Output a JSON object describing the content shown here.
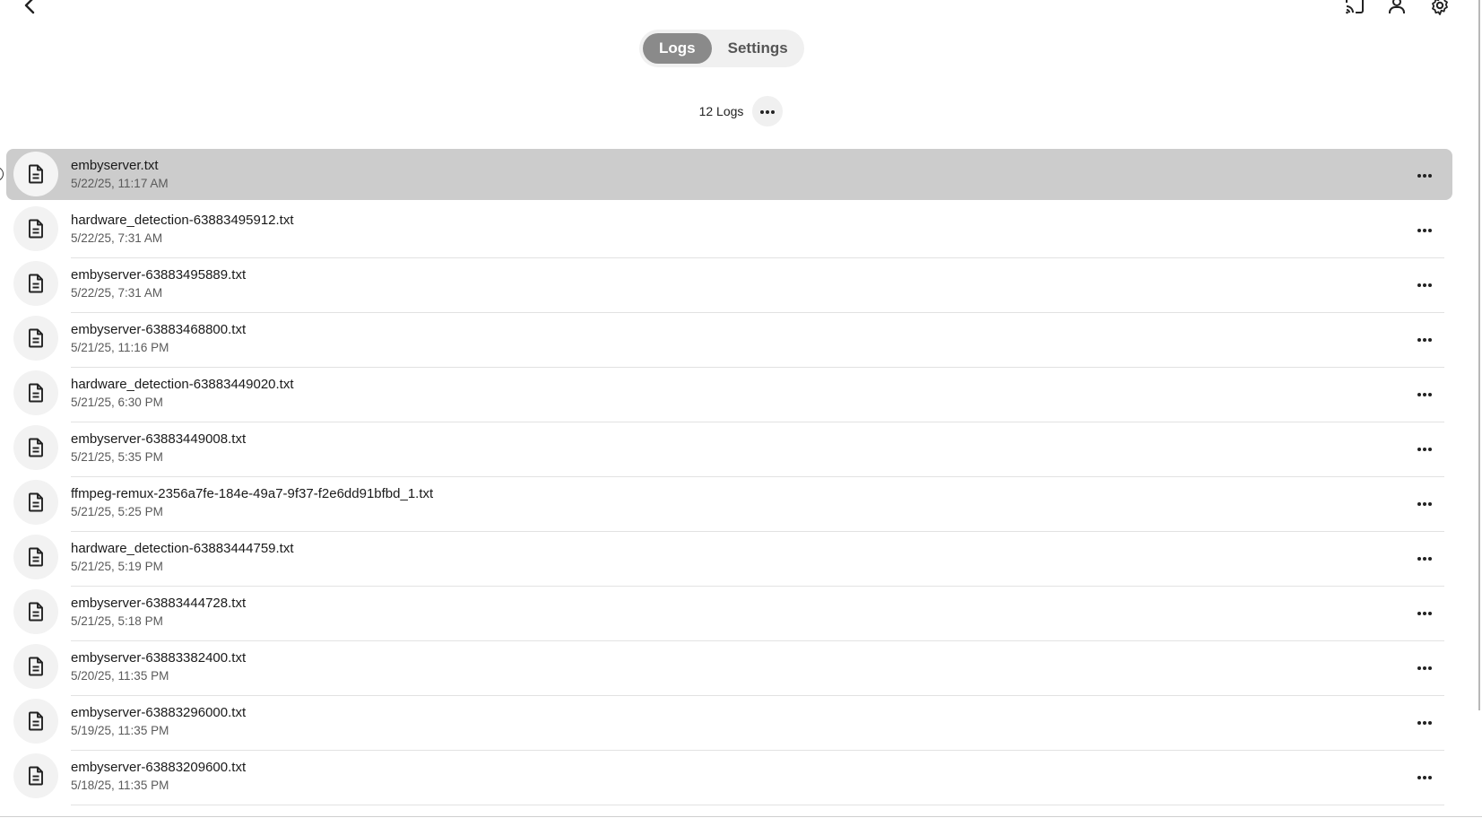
{
  "header": {
    "back_icon": "chevron-left-icon",
    "cast_icon": "cast-icon",
    "user_icon": "user-icon",
    "settings_icon": "gear-icon"
  },
  "tabs": [
    {
      "label": "Logs",
      "active": true
    },
    {
      "label": "Settings",
      "active": false
    }
  ],
  "summary": {
    "count_label": "12 Logs",
    "more_icon": "ellipsis-icon"
  },
  "logs": [
    {
      "name": "embyserver.txt",
      "date": "5/22/25, 11:17 AM",
      "selected": true
    },
    {
      "name": "hardware_detection-63883495912.txt",
      "date": "5/22/25, 7:31 AM"
    },
    {
      "name": "embyserver-63883495889.txt",
      "date": "5/22/25, 7:31 AM"
    },
    {
      "name": "embyserver-63883468800.txt",
      "date": "5/21/25, 11:16 PM"
    },
    {
      "name": "hardware_detection-63883449020.txt",
      "date": "5/21/25, 6:30 PM"
    },
    {
      "name": "embyserver-63883449008.txt",
      "date": "5/21/25, 5:35 PM"
    },
    {
      "name": "ffmpeg-remux-2356a7fe-184e-49a7-9f37-f2e6dd91bfbd_1.txt",
      "date": "5/21/25, 5:25 PM"
    },
    {
      "name": "hardware_detection-63883444759.txt",
      "date": "5/21/25, 5:19 PM"
    },
    {
      "name": "embyserver-63883444728.txt",
      "date": "5/21/25, 5:18 PM"
    },
    {
      "name": "embyserver-63883382400.txt",
      "date": "5/20/25, 11:35 PM"
    },
    {
      "name": "embyserver-63883296000.txt",
      "date": "5/19/25, 11:35 PM"
    },
    {
      "name": "embyserver-63883209600.txt",
      "date": "5/18/25, 11:35 PM"
    }
  ],
  "row_icons": {
    "file": "file-text-icon",
    "more": "ellipsis-icon"
  },
  "colors": {
    "active_tab": "#8a8a8a",
    "selected_row": "#cccccc"
  }
}
